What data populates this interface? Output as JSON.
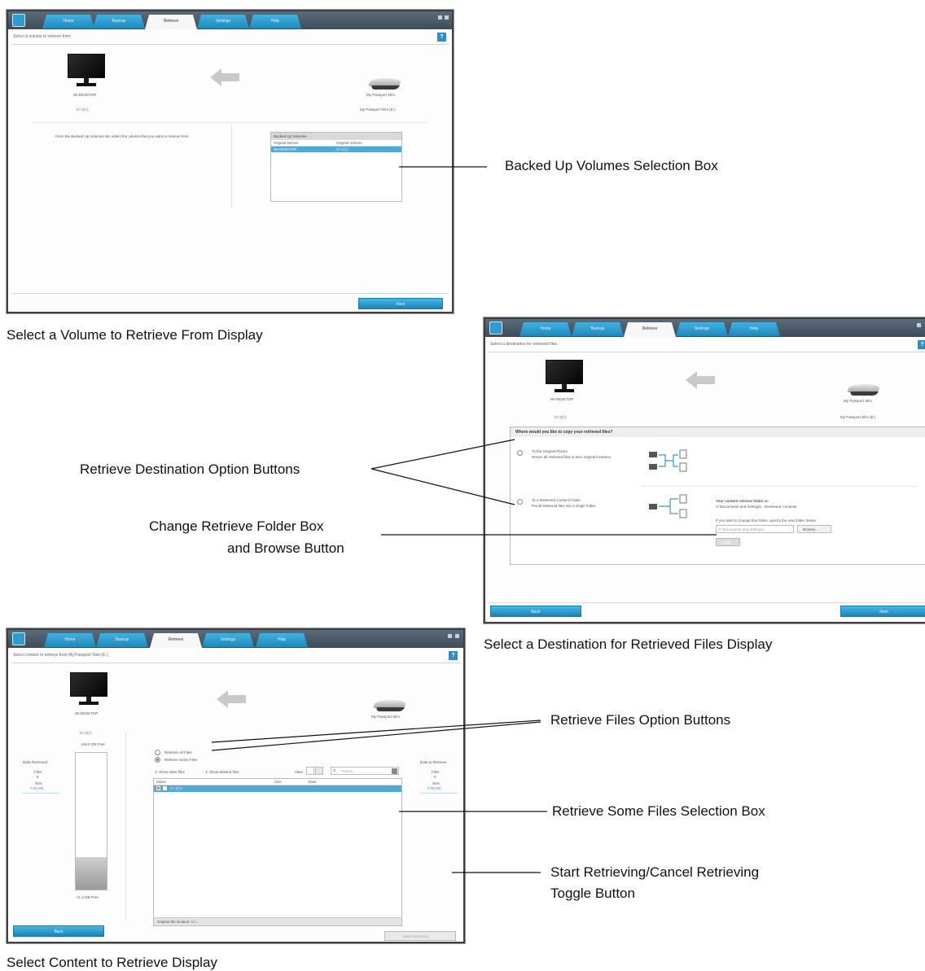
{
  "callouts": {
    "backed_up_volumes": "Backed Up Volumes Selection Box",
    "retrieve_destination_options": "Retrieve Destination Option Buttons",
    "change_folder_line1": "Change Retrieve Folder Box",
    "change_folder_line2": "and Browse Button",
    "retrieve_files_options": "Retrieve Files Option Buttons",
    "retrieve_some_files": "Retrieve Some Files Selection Box",
    "toggle_line1": "Start Retrieving/Cancel Retrieving",
    "toggle_line2": "Toggle Button"
  },
  "captions": {
    "screen1": "Select a Volume to Retrieve From Display",
    "screen2": "Select a Destination for Retrieved Files Display",
    "screen3": "Select Content to Retrieve Display"
  },
  "tabs": {
    "home": "Home",
    "backup": "Backup",
    "retrieve": "Retrieve",
    "settings": "Settings",
    "help": "Help"
  },
  "screen1": {
    "crumb": "Select a volume to retrieve from.",
    "computer_name": "WI-DESKTOP",
    "computer_volume": "C:\\ (C:)",
    "drive_name": "My Passport Slim",
    "drive_volume": "My Passport Slim (E:)",
    "instructions": "From the Backed Up Volumes list, select the volume that you want to retrieve from.",
    "box_title": "Backed Up Volumes",
    "col1": "Original Device",
    "col2": "Original Volume",
    "row_device": "WI-DESKTOP",
    "row_volume": "C:\\ (C:)",
    "next": "Next"
  },
  "screen2": {
    "crumb": "Select a destination for retrieved files.",
    "computer_name": "WI-DESKTOP",
    "computer_volume": "C:\\ (C:)",
    "drive_name": "My Passport Slim",
    "drive_volume": "My Passport Slim (E:)",
    "question": "Where would you like to copy your retrieved files?",
    "opt1_title": "To the Original Places",
    "opt1_desc": "Return all retrieved files to their original locations.",
    "opt2_title": "To a Retrieved Content Folder",
    "opt2_desc": "Put all retrieved files into a single folder.",
    "folder_title": "Your content retrieve folder is:",
    "folder_path": "C:\\Documents and Settings\\...\\Retrieved Contents",
    "folder_hint": "If you want to change this folder, specify the new folder below:",
    "folder_input": "C:\\Documents and Settings\\...",
    "browse": "Browse...",
    "apply": "Apply",
    "back": "Back",
    "next": "Next"
  },
  "screen3": {
    "crumb": "Select content to retrieve from My Passport Slim (E:).",
    "computer_name": "WI-DESKTOP",
    "computer_volume": "C:\\ (C:)",
    "computer_free": "149.0 GB Free",
    "computer_used": "71.4 GB Free",
    "drive_name": "My Passport Slim",
    "left_panel_title": "Data Retrieved",
    "left_files_label": "Files",
    "left_files_value": "0",
    "left_size_label": "Size",
    "left_size_value": "0.00 KB",
    "right_panel_title": "Data to Retrieve",
    "right_files_label": "Files",
    "right_files_value": "0",
    "right_size_label": "Size",
    "right_size_value": "0.00 KB",
    "opt_all": "Retrieve All Files",
    "opt_some": "Retrieve Some Files",
    "show_older": "Show older files",
    "show_deleted": "Show deleted files",
    "view": "View:",
    "search": "Search",
    "col_name": "Name",
    "col_size": "Size",
    "col_date": "Date",
    "tree_row": "C:\\ (C:)",
    "footer": "Original file location: C:\\...",
    "start": "Start Retrieving",
    "back": "Back"
  }
}
